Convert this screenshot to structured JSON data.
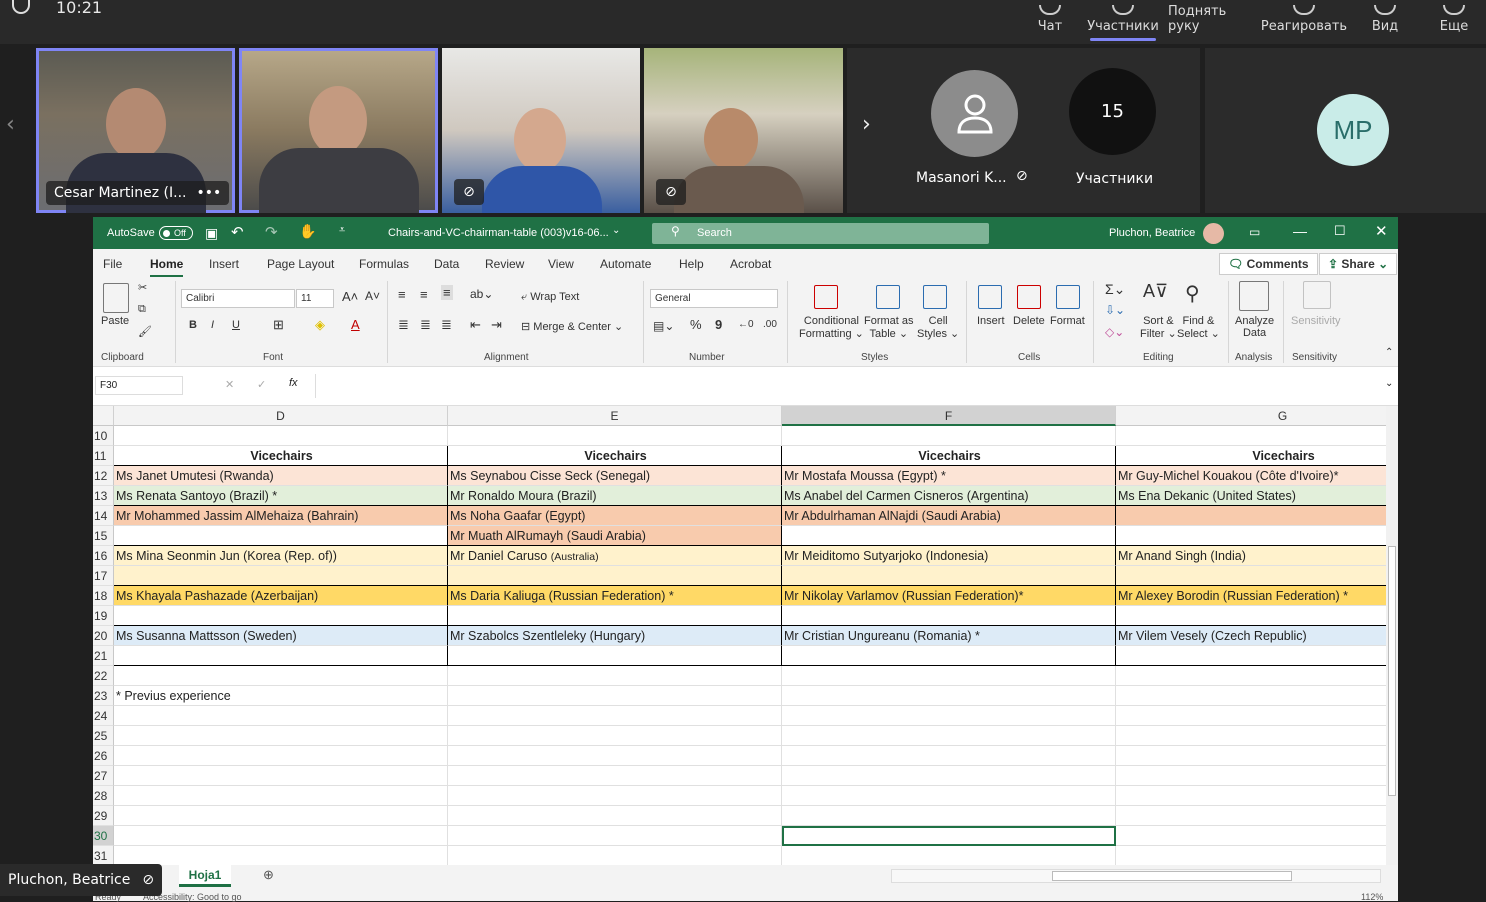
{
  "teams": {
    "time": "10:21",
    "nav": [
      {
        "label": "Чат",
        "icon": "chat-icon"
      },
      {
        "label": "Участники",
        "icon": "people-icon"
      },
      {
        "label": "Поднять руку",
        "icon": "hand-icon"
      },
      {
        "label": "Реагировать",
        "icon": "reaction-icon"
      },
      {
        "label": "Вид",
        "icon": "view-icon"
      },
      {
        "label": "Еще",
        "icon": "more-icon"
      }
    ],
    "tiles": [
      {
        "name": "Cesar Martinez (I...",
        "more": "•••"
      },
      {
        "name": ""
      },
      {
        "name": ""
      },
      {
        "name": ""
      }
    ],
    "masanori_name": "Masanori K...",
    "participants_count": "15",
    "participants_label": "Участники",
    "mp_initials": "MP",
    "presenter_name": "Pluchon, Beatrice",
    "accent": "#7f85f5"
  },
  "excel": {
    "autosave": "AutoSave",
    "toggle": "Off",
    "filename": "Chairs-and-VC-chairman-table (003)v16-06...",
    "search": "Search",
    "user": "Pluchon, Beatrice",
    "menu": [
      "File",
      "Home",
      "Insert",
      "Page Layout",
      "Formulas",
      "Data",
      "Review",
      "View",
      "Automate",
      "Help",
      "Acrobat"
    ],
    "comments": "Comments",
    "share": "Share",
    "ribbon": {
      "paste": "Paste",
      "clipboard": "Clipboard",
      "font_name": "Calibri",
      "font_size": "11",
      "font": "Font",
      "wrap": "Wrap Text",
      "merge": "Merge & Center",
      "alignment": "Alignment",
      "number_format": "General",
      "number": "Number",
      "cond1": "Conditional",
      "cond2": "Formatting",
      "fmt1": "Format as",
      "fmt2": "Table",
      "cell1": "Cell",
      "cell2": "Styles",
      "styles": "Styles",
      "insert": "Insert",
      "delete": "Delete",
      "format": "Format",
      "cells": "Cells",
      "sort1": "Sort &",
      "sort2": "Filter",
      "find1": "Find &",
      "find2": "Select",
      "editing": "Editing",
      "analyze1": "Analyze",
      "analyze2": "Data",
      "analysis": "Analysis",
      "sens": "Sensitivity",
      "sensitivity": "Sensitivity",
      "bold": "B",
      "italic": "I",
      "underline": "U",
      "percent": "%"
    },
    "namebox": "F30",
    "fx": "fx",
    "columns": [
      "D",
      "E",
      "F",
      "G"
    ],
    "rows": [
      "10",
      "11",
      "12",
      "13",
      "14",
      "15",
      "16",
      "17",
      "18",
      "19",
      "20",
      "21",
      "22",
      "23",
      "24",
      "25",
      "26",
      "27",
      "28",
      "29",
      "30",
      "31"
    ],
    "header_row": [
      "Vicechairs",
      "Vicechairs",
      "Vicechairs",
      "Vicechairs"
    ],
    "r12": [
      "Ms Janet Umutesi (Rwanda)",
      "Ms Seynabou Cisse Seck (Senegal)",
      "Mr Mostafa Moussa (Egypt) *",
      "Mr Guy-Michel Kouakou (Côte d'Ivoire)*"
    ],
    "r13": [
      " Ms Renata Santoyo (Brazil) *",
      "Mr Ronaldo Moura (Brazil)",
      "Ms Anabel del Carmen Cisneros (Argentina)",
      "Ms Ena Dekanic (United States)"
    ],
    "r14": [
      "Mr Mohammed Jassim AlMehaiza (Bahrain)",
      "Ms Noha Gaafar (Egypt)",
      "Mr Abdulrhaman AlNajdi (Saudi Arabia)",
      ""
    ],
    "r15": [
      "",
      "Mr Muath AlRumayh (Saudi Arabia)",
      "",
      ""
    ],
    "r16": [
      "Ms Mina Seonmin Jun (Korea (Rep. of))",
      "Mr Daniel Caruso",
      "Mr Meiditomo Sutyarjoko (Indonesia)",
      "Mr Anand Singh (India)"
    ],
    "r16_small": "(Australia)",
    "r18": [
      "Ms Khayala Pashazade (Azerbaijan)",
      "Ms Daria Kaliuga (Russian Federation) *",
      "Mr Nikolay Varlamov (Russian Federation)*",
      "Mr Alexey Borodin (Russian Federation) *"
    ],
    "r20": [
      "Ms Susanna Mattsson (Sweden)",
      "Mr Szabolcs Szentleleky (Hungary)",
      "Mr Cristian Ungureanu (Romania) *",
      "Mr Vilem Vesely (Czech Republic)"
    ],
    "r23": "* Previus experience",
    "sheet": "Hoja1",
    "status": "Ready",
    "accessibility": "Accessibility: Good to go",
    "zoom": "112%",
    "colors": {
      "green": "#1f7145",
      "pink": "#fce4d6",
      "lightgreen": "#e2efda",
      "orange": "#f8cbad",
      "cream": "#fff2cc",
      "gold": "#ffd966",
      "blue": "#ddebf7"
    }
  }
}
